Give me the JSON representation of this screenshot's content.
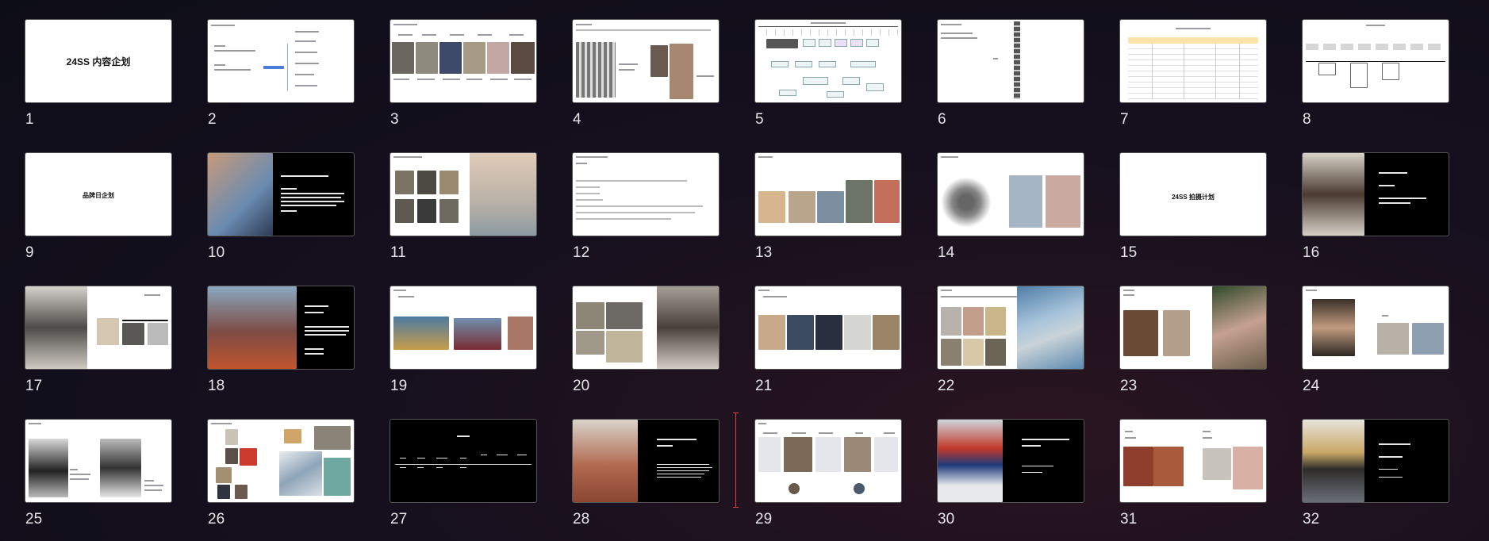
{
  "slides": [
    {
      "num": "1",
      "title": "24SS 内容企划"
    },
    {
      "num": "2"
    },
    {
      "num": "3"
    },
    {
      "num": "4"
    },
    {
      "num": "5"
    },
    {
      "num": "6"
    },
    {
      "num": "7"
    },
    {
      "num": "8"
    },
    {
      "num": "9",
      "title": "品牌日企划"
    },
    {
      "num": "10"
    },
    {
      "num": "11"
    },
    {
      "num": "12"
    },
    {
      "num": "13"
    },
    {
      "num": "14"
    },
    {
      "num": "15",
      "title": "24SS 拍摄计划"
    },
    {
      "num": "16"
    },
    {
      "num": "17"
    },
    {
      "num": "18"
    },
    {
      "num": "19"
    },
    {
      "num": "20"
    },
    {
      "num": "21"
    },
    {
      "num": "22"
    },
    {
      "num": "23"
    },
    {
      "num": "24"
    },
    {
      "num": "25"
    },
    {
      "num": "26"
    },
    {
      "num": "27"
    },
    {
      "num": "28"
    },
    {
      "num": "29"
    },
    {
      "num": "30"
    },
    {
      "num": "31"
    },
    {
      "num": "32"
    }
  ],
  "colors": {
    "background": "#16101e",
    "drop_indicator": "#e04040",
    "slide_border": "#555555"
  }
}
